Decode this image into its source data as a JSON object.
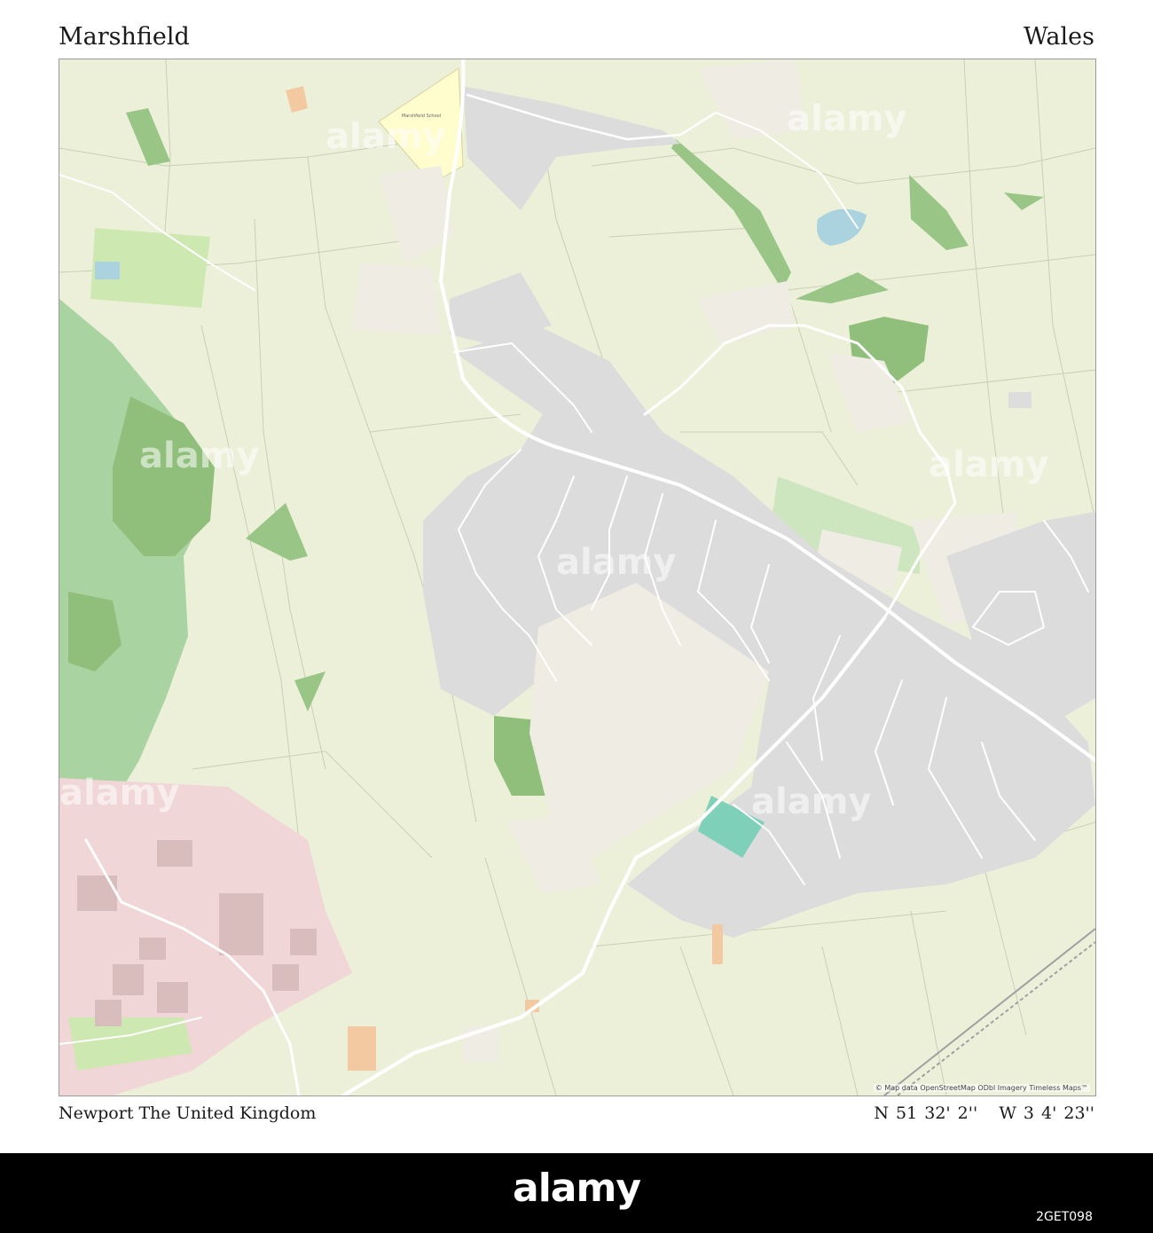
{
  "poster": {
    "title": "Marshfield",
    "region": "Wales",
    "subtitle": "Newport The United Kingdom",
    "latitude": "N 51 32' 2''",
    "longitude": "W 3 4' 23''"
  },
  "map": {
    "attribution": "© Map data OpenStreetMap ODbl Imagery Timeless Maps™",
    "school_label": "Marshfield School",
    "watermark": "alamy",
    "colors": {
      "farmland": "#ecf0d9",
      "wood": "#a9d3a0",
      "forest": "#99c587",
      "residential": "#dcdcdc",
      "retail": "#f0d6d6",
      "school": "#fffcce",
      "water": "#aad3df",
      "road": "#ffffff"
    }
  },
  "footer": {
    "brand": "alamy",
    "image_id": "2GET098"
  }
}
